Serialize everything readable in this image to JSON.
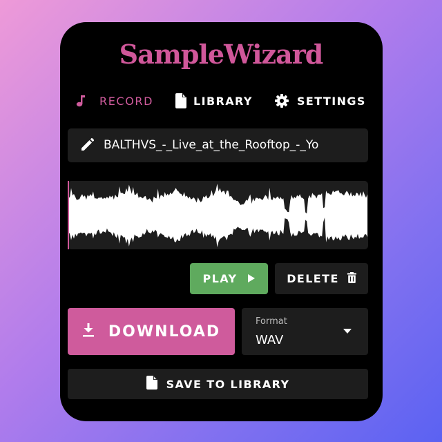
{
  "app": {
    "title": "SampleWizard"
  },
  "nav": {
    "record_label": "RECORD",
    "library_label": "LIBRARY",
    "settings_label": "SETTINGS",
    "active": "record"
  },
  "file": {
    "name": "BALTHVS_-_Live_at_the_Rooftop_-_Yo"
  },
  "actions": {
    "play_label": "PLAY",
    "delete_label": "DELETE",
    "download_label": "DOWNLOAD",
    "save_label": "SAVE TO LIBRARY"
  },
  "format": {
    "label": "Format",
    "value": "WAV"
  },
  "colors": {
    "accent": "#cf5b9c",
    "play": "#5faa5e",
    "panel": "#1d1d1d",
    "card": "#000000"
  },
  "icons": {
    "record": "music-note-icon",
    "library": "document-icon",
    "settings": "gear-icon",
    "rename": "pencil-icon",
    "play": "play-icon",
    "delete": "trash-icon",
    "download": "download-icon",
    "format": "caret-down-icon",
    "save": "document-icon"
  }
}
